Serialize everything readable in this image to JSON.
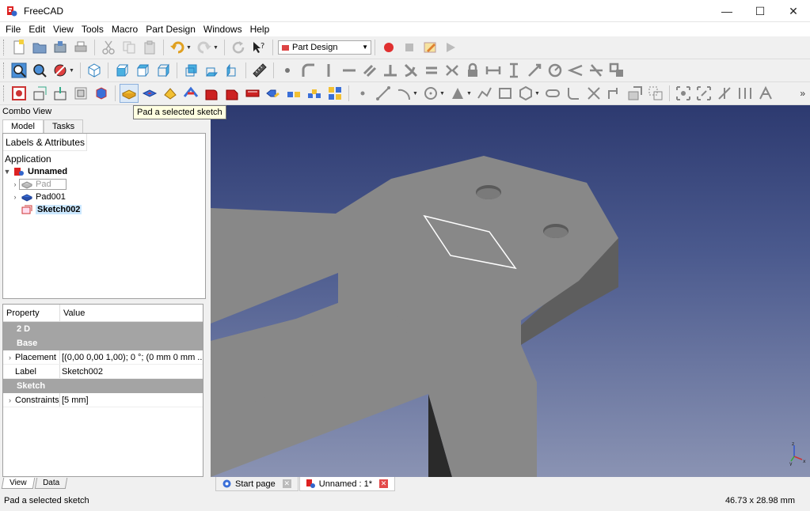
{
  "window": {
    "title": "FreeCAD",
    "minimize": "—",
    "maximize": "☐",
    "close": "✕"
  },
  "menu": [
    "File",
    "Edit",
    "View",
    "Tools",
    "Macro",
    "Part Design",
    "Windows",
    "Help"
  ],
  "workbench": {
    "selected": "Part Design"
  },
  "tooltip": "Pad a selected sketch",
  "combo_view": {
    "title": "Combo View",
    "tabs": [
      "Model",
      "Tasks"
    ],
    "tree_header": "Labels & Attributes",
    "application_label": "Application",
    "tree": {
      "document": "Unnamed",
      "items": [
        "Pad",
        "Pad001",
        "Sketch002"
      ]
    }
  },
  "properties": {
    "col_property": "Property",
    "col_value": "Value",
    "group_2d": "2 D",
    "group_base": "Base",
    "placement_label": "Placement",
    "placement_value": "[(0,00 0,00 1,00); 0 °; (0 mm  0 mm ...",
    "label_label": "Label",
    "label_value": "Sketch002",
    "group_sketch": "Sketch",
    "constraints_label": "Constraints",
    "constraints_value": "[5 mm]"
  },
  "bottom_tabs": [
    "View",
    "Data"
  ],
  "doc_tabs": [
    "Start page",
    "Unnamed : 1*"
  ],
  "status": {
    "message": "Pad a selected sketch",
    "dimensions": "46.73 x 28.98 mm"
  },
  "colors": {
    "viewport_top": "#2d3a70",
    "viewport_bottom": "#8a93b3",
    "part_face": "#888888",
    "part_side": "#5a5a5a"
  }
}
